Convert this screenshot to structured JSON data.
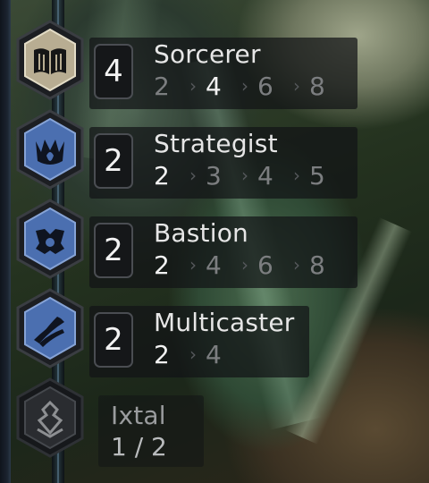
{
  "colors": {
    "active_hex_fill": "#4b6fb0",
    "active_hex_border": "#2b2f36",
    "sorcerer_hex_fill": "#b8ad92",
    "inactive_hex_fill": "#2a2c30",
    "text_on": "#f2f2f2",
    "text_off": "#7c7e80"
  },
  "traits": [
    {
      "name": "Sorcerer",
      "icon": "open-book-icon",
      "count": "4",
      "breakpoints": [
        "2",
        "4",
        "6",
        "8"
      ],
      "active_breakpoints": 2
    },
    {
      "name": "Strategist",
      "icon": "crown-flame-icon",
      "count": "2",
      "breakpoints": [
        "2",
        "3",
        "4",
        "5"
      ],
      "active_breakpoints": 1
    },
    {
      "name": "Bastion",
      "icon": "shield-crest-icon",
      "count": "2",
      "breakpoints": [
        "2",
        "4",
        "6",
        "8"
      ],
      "active_breakpoints": 1
    },
    {
      "name": "Multicaster",
      "icon": "triple-bolt-icon",
      "count": "2",
      "breakpoints": [
        "2",
        "4"
      ],
      "active_breakpoints": 1
    }
  ],
  "inactive_trait": {
    "name": "Ixtal",
    "icon": "ixtal-emblem-icon",
    "progress": "1 / 2"
  }
}
